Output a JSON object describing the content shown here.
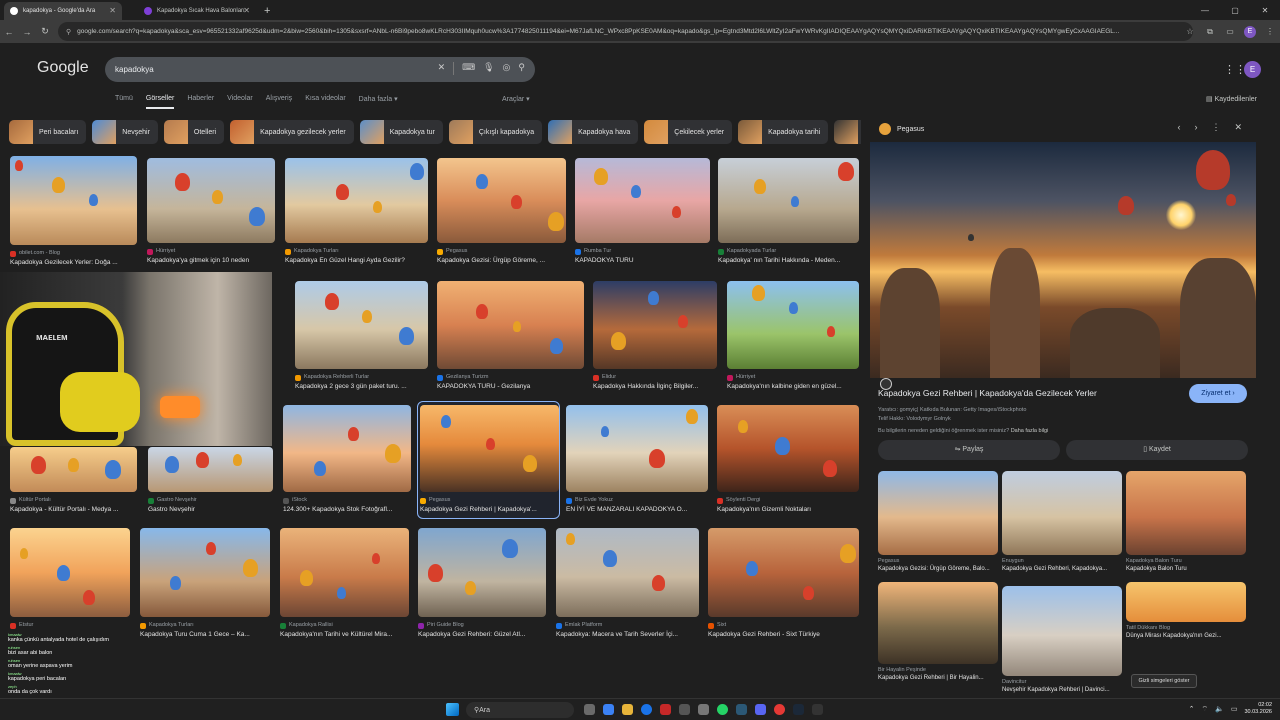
{
  "browser": {
    "tabs": [
      {
        "title": "kapadokya - Google'da Ara",
        "active": true
      },
      {
        "title": "Kapadokya Sıcak Hava Balonları",
        "active": false
      }
    ],
    "url": "google.com/search?q=kapadokya&sca_esv=965521332af9625d&udm=2&biw=2560&bih=1305&sxsrf=ANbL-n6Bi9pebo8wKLRcH303IIMquh0ucw%3A1774825011194&ei=M67JafLNC_WPxc8PpKSE0AM&oq=kapado&gs_lp=Egtnd3Mtd2l6LWltZyI2aFwYWRvKgIIADIQEAAYgAQYsQMYQxiDARiKBTIKEAAYgAQYQxiKBTIKEAAYgAQYsQMYgwEyCxAAGIAEGL..."
  },
  "google": {
    "logo": "Google",
    "query": "kapadokya",
    "nav_tabs": [
      "Tümü",
      "Görseller",
      "Haberler",
      "Videolar",
      "Alışveriş",
      "Kısa videolar",
      "Daha fazla ▾"
    ],
    "active_tab": "Görseller",
    "tools": "Araçlar ▾",
    "saved": "Kaydedilenler",
    "avatar": "E"
  },
  "chips": [
    "Peri bacaları",
    "Nevşehir",
    "Otelleri",
    "Kapadokya gezilecek yerler",
    "Kapadokya tur",
    "Çıkışlı kapadokya",
    "Kapadokya hava",
    "Çekilecek yerler",
    "Kapadokya tarihi",
    "K"
  ],
  "results": [
    {
      "source": "obilet.com - Blog",
      "title": "Kapadokya Gezilecek Yerler: Doğa ..."
    },
    {
      "source": "Hürriyet",
      "title": "Kapadokya'ya gitmek için 10 neden"
    },
    {
      "source": "Kapadokya Turları",
      "title": "Kapadokya En Güzel Hangi Ayda Gezilir?"
    },
    {
      "source": "Pegasus",
      "title": "Kapadokya Gezisi: Ürgüp Göreme, ..."
    },
    {
      "source": "Rumba Tur",
      "title": "KAPADOKYA TURU"
    },
    {
      "source": "Kapadokyada Turlar",
      "title": "Kapadokya' nın Tarihi Hakkında - Meden..."
    },
    {
      "source": "Kapadokya Rehberli Turlar",
      "title": "Kapadokya 2 gece 3 gün paket turu. ..."
    },
    {
      "source": "Gezilanya Turizm",
      "title": "KAPADOKYA TURU - Gezilanya"
    },
    {
      "source": "Elidur",
      "title": "Kapadokya Hakkında İlginç Bilgiler..."
    },
    {
      "source": "Hürriyet",
      "title": "Kapadokya'nın kalbine giden en güzel..."
    },
    {
      "source": "Kültür Portalı",
      "title": "Kapadokya - Kültür Portalı - Medya ..."
    },
    {
      "source": "Gastro Nevşehir",
      "title": "Gastro Nevşehir"
    },
    {
      "source": "iStock",
      "title": "124.300+ Kapadokya Stok Fotoğrafl..."
    },
    {
      "source": "Pegasus",
      "title": "Kapadokya Gezi Rehberi | Kapadokya'..."
    },
    {
      "source": "Biz Evde Yokuz",
      "title": "EN İYİ VE MANZARALI KAPADOKYA O..."
    },
    {
      "source": "Söylenti Dergi",
      "title": "Kapadokya'nın Gizemli Noktaları"
    },
    {
      "source": "Etstur",
      "title": ""
    },
    {
      "source": "Kapadokya Turları",
      "title": "Kapadokya Turu Cuma 1 Gece – Ka..."
    },
    {
      "source": "Kapadokya Rallisi",
      "title": "Kapadokya'nın Tarihi ve Kültürel Mira..."
    },
    {
      "source": "Piri Guide Blog",
      "title": "Kapadokya Gezi Rehberi: Güzel Atl..."
    },
    {
      "source": "Emlak Platform",
      "title": "Kapadokya: Macera ve Tarih Severler İçi..."
    },
    {
      "source": "Sixt",
      "title": "Kapadokya Gezi Rehberi - Sixt Türkiye"
    }
  ],
  "webcam": {
    "chair_label": "ᴍᴀᴇʟᴇᴍ"
  },
  "panel": {
    "source": "Pegasus",
    "title": "Kapadokya Gezi Rehberi | Kapadokya'da Gezilecek Yerler",
    "visit": "Ziyaret et ›",
    "creator": "Yaratıcı: gomyiç| Katkıda Bulunan: Getty Images/iStockphoto",
    "copyright": "Telif Hakkı: Volodymyr Golnyk",
    "learn": "Bu bilgilerin nereden geldiğini öğrenmek ister misiniz?",
    "learn_link": "Daha fazla bilgi",
    "share": "Paylaş",
    "save": "Kaydet",
    "related": [
      {
        "source": "Pegasus",
        "title": "Kapadokya Gezisi: Ürgüp Göreme, Balo..."
      },
      {
        "source": "Enuygun",
        "title": "Kapadokya Gezi Rehberi, Kapadokya..."
      },
      {
        "source": "Kapadokya Balon Turu",
        "title": "Kapadokya Balon Turu"
      },
      {
        "source": "Bir Hayalin Peşinde",
        "title": "Kapadokya Gezi Rehberi | Bir Hayalin..."
      },
      {
        "source": "Davincitur",
        "title": "Nevşehir Kapadokya Rehberi | Davinci..."
      },
      {
        "source": "Tatil Dükkanı Blog",
        "title": "Dünya Mirası Kapadokya'nın Gezi..."
      }
    ]
  },
  "tooltip": "Gizli simgeleri göster",
  "chat": [
    {
      "user": "kmaalw",
      "msg": "kanka çünkü antalyada hotel de çalışıdım"
    },
    {
      "user": "ruhsen",
      "msg": "bizi asar abi balon"
    },
    {
      "user": "ruhsen",
      "msg": "oman yerine aspava yerim"
    },
    {
      "user": "kmaalw",
      "msg": "kapadokya peri bacaları"
    },
    {
      "user": "zeph",
      "msg": "onda da çok vardı"
    }
  ],
  "taskbar": {
    "search": "Ara",
    "time": "02:02",
    "date": "30.03.2026"
  },
  "colors": {
    "accent": "#8ab4f8",
    "bg": "#1f1f1f",
    "chip": "#303134"
  }
}
